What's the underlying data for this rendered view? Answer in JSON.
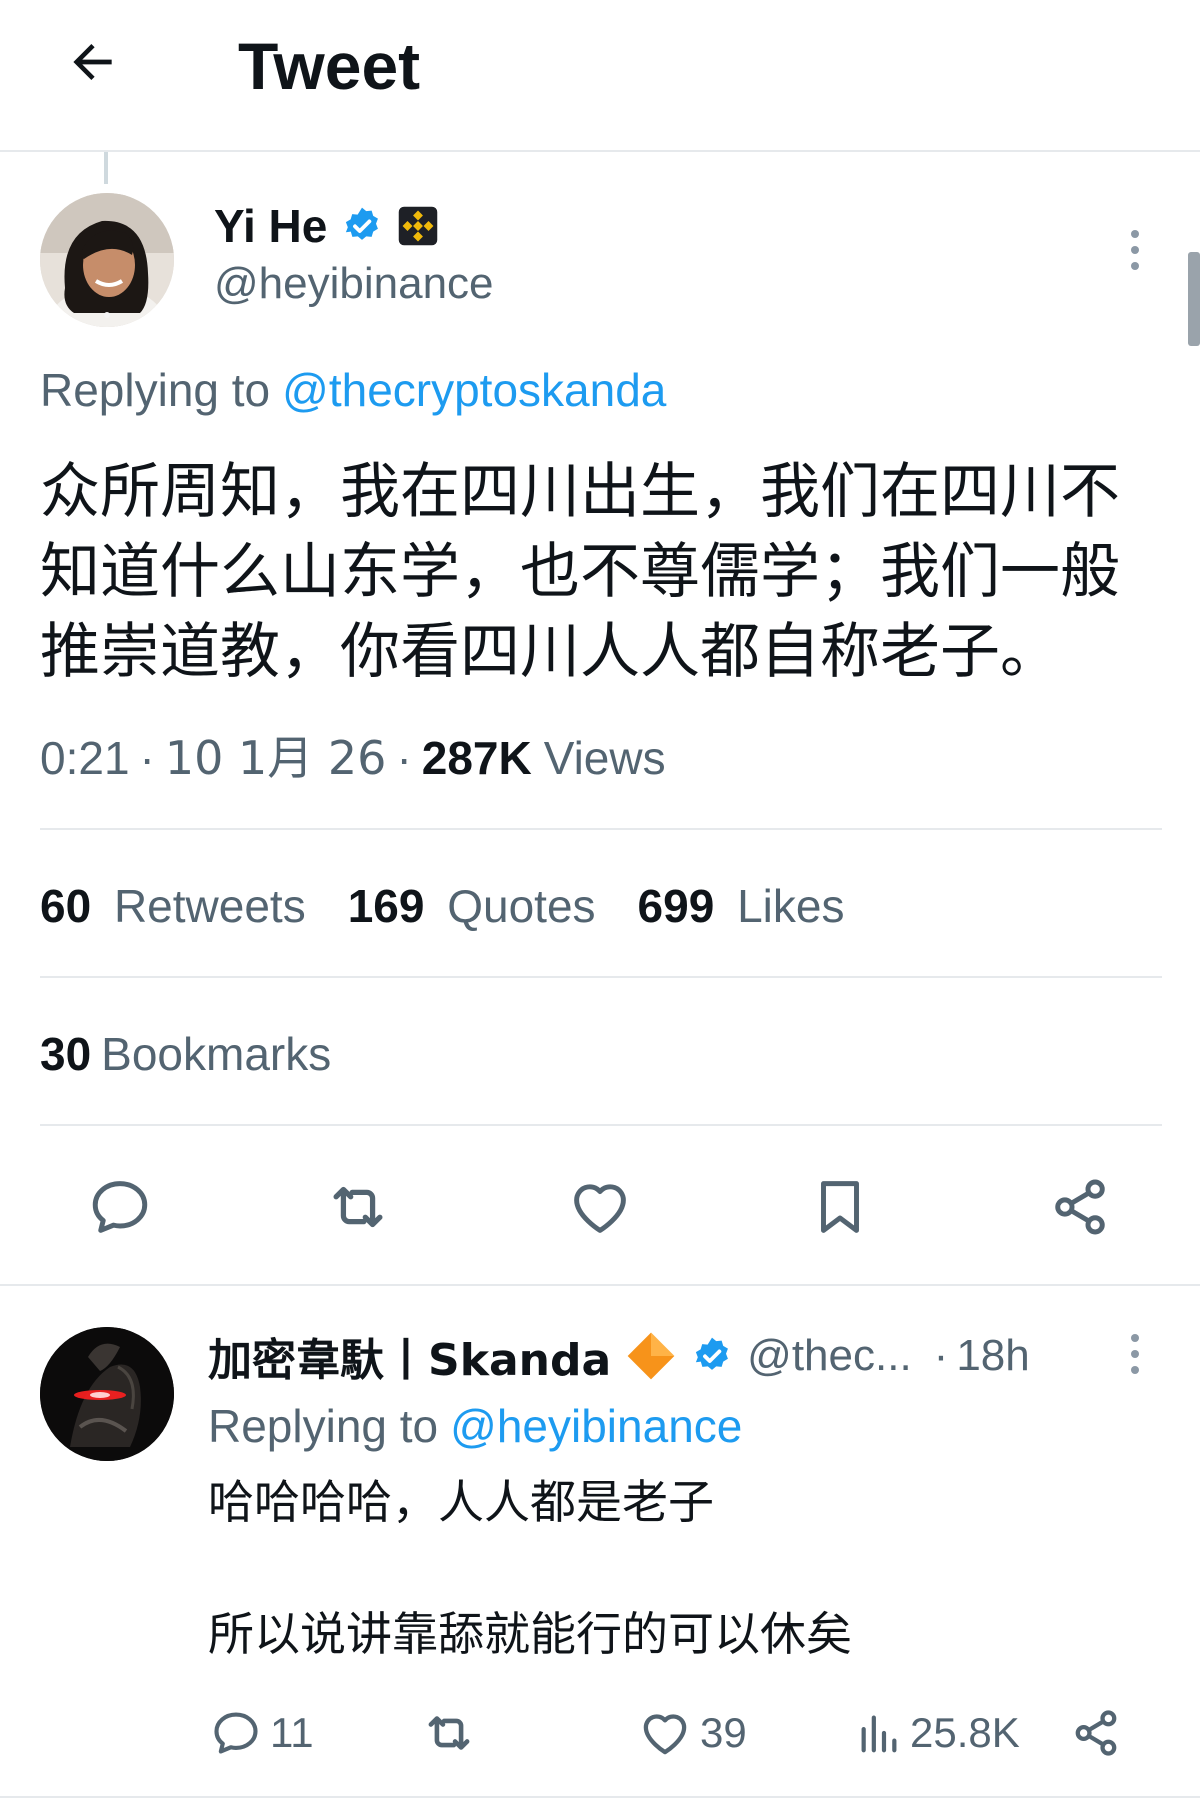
{
  "header": {
    "title": "Tweet"
  },
  "tweet": {
    "author_name": "Yi He",
    "author_handle": "@heyibinance",
    "replying_prefix": "Replying to",
    "replying_to": "@thecryptoskanda",
    "text_lines": [
      "众所周知，我在四川出生，我们在四川不",
      "知道什么山东学，也不尊儒学；我们一般",
      "推崇道教，你看四川人人都自称老子。"
    ],
    "time": "0:21",
    "date": "10 1月 26",
    "separator": "·",
    "views_count": "287K",
    "views_label": "Views",
    "stats": {
      "retweets_count": "60",
      "retweets_label": "Retweets",
      "quotes_count": "169",
      "quotes_label": "Quotes",
      "likes_count": "699",
      "likes_label": "Likes",
      "bookmarks_count": "30",
      "bookmarks_label": "Bookmarks"
    },
    "actions": [
      "reply-icon",
      "retweet-icon",
      "like-icon",
      "bookmark-icon",
      "share-icon"
    ]
  },
  "reply": {
    "author_name": "加密韋馱丨Skanda",
    "author_handle": "@thec...",
    "time": "18h",
    "separator": "·",
    "replying_prefix": "Replying to",
    "replying_to": "@heyibinance",
    "text_line1": "哈哈哈哈，人人都是老子",
    "text_line2": "所以说讲靠舔就能行的可以休矣",
    "reply_count": "11",
    "like_count": "39",
    "views_count": "25.8K"
  },
  "colors": {
    "accent": "#1d9bf0",
    "muted": "#536471",
    "text": "#0f1419",
    "binance_yellow": "#f0b90b",
    "orange": "#f7931a"
  }
}
